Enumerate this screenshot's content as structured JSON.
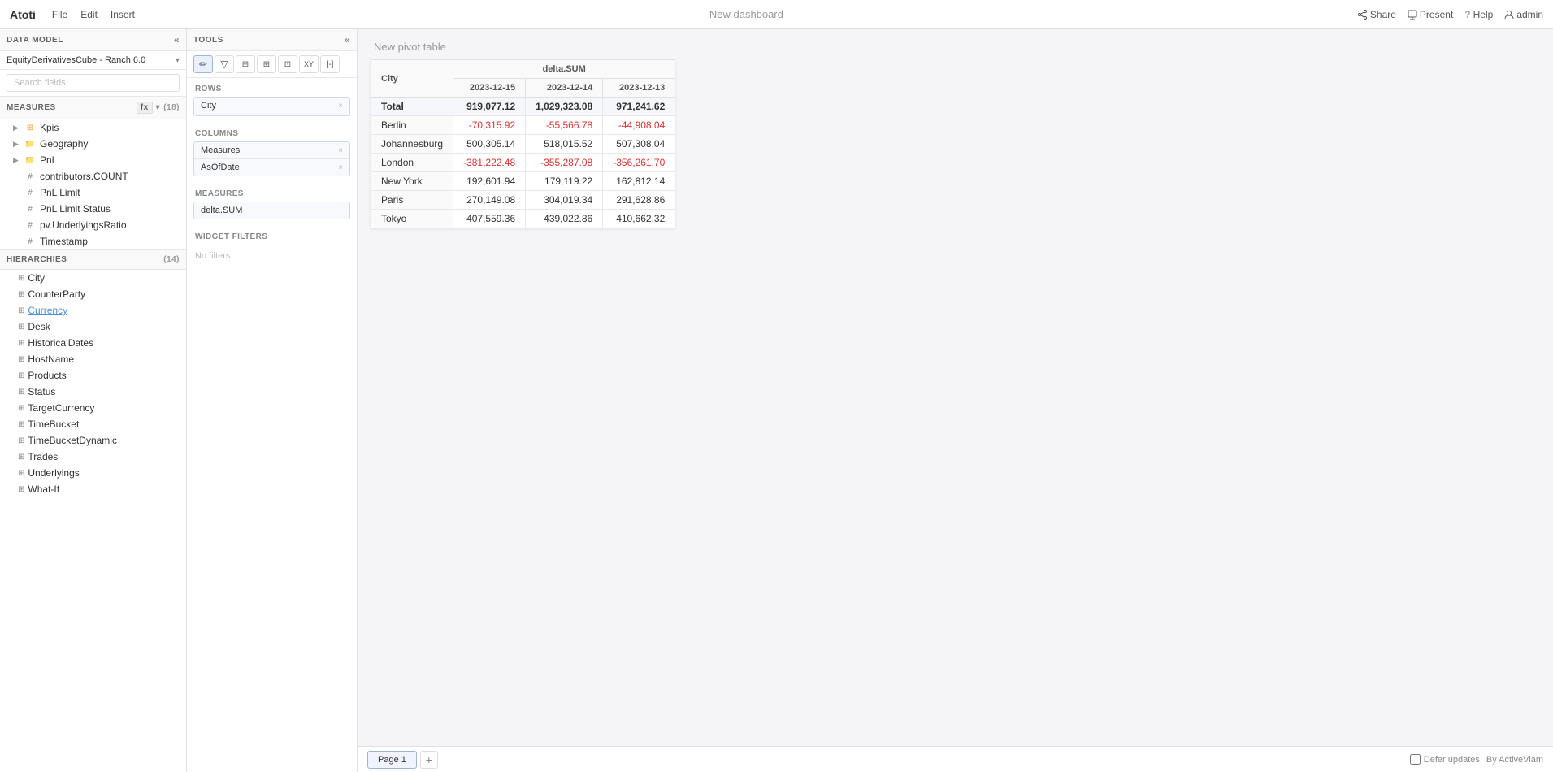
{
  "app": {
    "logo": "Atoti",
    "menu": [
      "File",
      "Edit",
      "Insert"
    ],
    "title": "New dashboard",
    "actions": {
      "share": "Share",
      "present": "Present",
      "help": "Help",
      "user": "admin"
    }
  },
  "left_panel": {
    "data_model_label": "DATA MODEL",
    "cube_name": "EquityDerivativesCube - Ranch 6.0",
    "search_placeholder": "Search fields",
    "measures_label": "MEASURES",
    "measures_count": "(18)",
    "fx_label": "fx",
    "measures_items": [
      {
        "type": "kpi",
        "label": "Kpis",
        "has_arrow": true
      },
      {
        "type": "folder",
        "label": "Geography",
        "has_arrow": true
      },
      {
        "type": "folder",
        "label": "PnL",
        "has_arrow": true
      },
      {
        "type": "hash",
        "label": "contributors.COUNT"
      },
      {
        "type": "hash",
        "label": "PnL Limit"
      },
      {
        "type": "hash",
        "label": "PnL Limit Status"
      },
      {
        "type": "hash",
        "label": "pv.UnderlyingsRatio"
      },
      {
        "type": "hash",
        "label": "Timestamp"
      }
    ],
    "hierarchies_label": "HIERARCHIES",
    "hierarchies_count": "(14)",
    "hierarchies_items": [
      {
        "label": "City",
        "underlined": false
      },
      {
        "label": "CounterParty",
        "underlined": false
      },
      {
        "label": "Currency",
        "underlined": true
      },
      {
        "label": "Desk",
        "underlined": false
      },
      {
        "label": "HistoricalDates",
        "underlined": false
      },
      {
        "label": "HostName",
        "underlined": false
      },
      {
        "label": "Products",
        "underlined": false
      },
      {
        "label": "Status",
        "underlined": false
      },
      {
        "label": "TargetCurrency",
        "underlined": false
      },
      {
        "label": "TimeBucket",
        "underlined": false
      },
      {
        "label": "TimeBucketDynamic",
        "underlined": false
      },
      {
        "label": "Trades",
        "underlined": false
      },
      {
        "label": "Underlyings",
        "underlined": false
      },
      {
        "label": "What-If",
        "underlined": false
      }
    ]
  },
  "tools_panel": {
    "label": "TOOLS",
    "toolbar_buttons": [
      "✏",
      "▽",
      "⊟",
      "⊞",
      "⊡",
      "XY",
      "[-]"
    ],
    "rows_label": "Rows",
    "rows_items": [
      "City"
    ],
    "columns_label": "Columns",
    "columns_items": [
      "Measures",
      "AsOfDate"
    ],
    "measures_label": "Measures",
    "measures_items": [
      "delta.SUM"
    ],
    "widget_filters_label": "Widget filters",
    "no_filters": "No filters"
  },
  "pivot": {
    "title": "New pivot table",
    "col_city": "City",
    "col_delta": "delta.SUM",
    "dates": [
      "2023-12-15",
      "2023-12-14",
      "2023-12-13"
    ],
    "rows": [
      {
        "city": "Total",
        "v1": "919,077.12",
        "v2": "1,029,323.08",
        "v3": "971,241.62",
        "is_total": true,
        "neg1": false,
        "neg2": false,
        "neg3": false
      },
      {
        "city": "Berlin",
        "v1": "-70,315.92",
        "v2": "-55,566.78",
        "v3": "-44,908.04",
        "is_total": false,
        "neg1": true,
        "neg2": true,
        "neg3": true
      },
      {
        "city": "Johannesburg",
        "v1": "500,305.14",
        "v2": "518,015.52",
        "v3": "507,308.04",
        "is_total": false,
        "neg1": false,
        "neg2": false,
        "neg3": false
      },
      {
        "city": "London",
        "v1": "-381,222.48",
        "v2": "-355,287.08",
        "v3": "-356,261.70",
        "is_total": false,
        "neg1": true,
        "neg2": true,
        "neg3": true
      },
      {
        "city": "New York",
        "v1": "192,601.94",
        "v2": "179,119.22",
        "v3": "162,812.14",
        "is_total": false,
        "neg1": false,
        "neg2": false,
        "neg3": false
      },
      {
        "city": "Paris",
        "v1": "270,149.08",
        "v2": "304,019.34",
        "v3": "291,628.86",
        "is_total": false,
        "neg1": false,
        "neg2": false,
        "neg3": false
      },
      {
        "city": "Tokyo",
        "v1": "407,559.36",
        "v2": "439,022.86",
        "v3": "410,662.32",
        "is_total": false,
        "neg1": false,
        "neg2": false,
        "neg3": false
      }
    ]
  },
  "bottom": {
    "page_tab": "Page 1",
    "add_page_label": "+",
    "defer_updates": "Defer updates",
    "by_label": "By ActiveViam"
  }
}
